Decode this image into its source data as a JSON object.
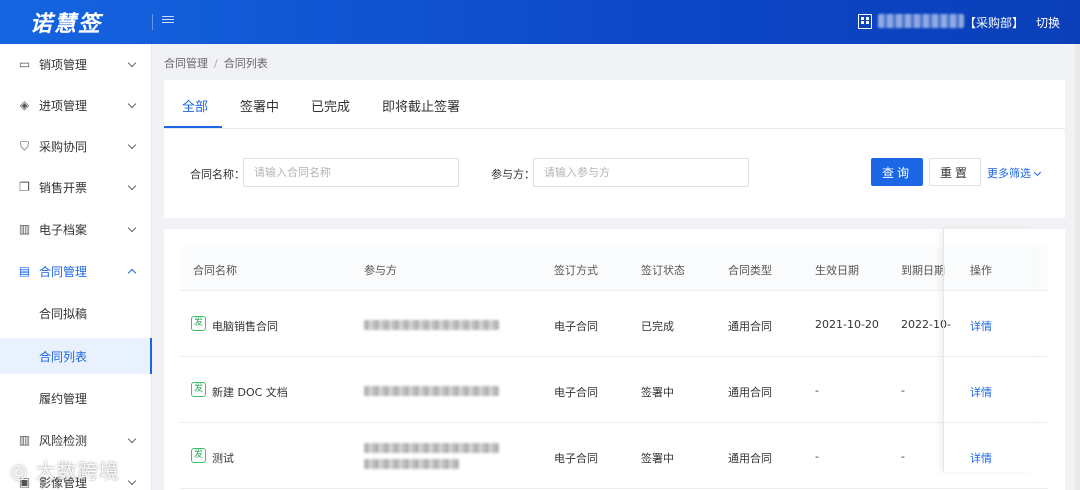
{
  "header": {
    "logo": "诺慧签",
    "dept": "【采购部】",
    "switch": "切换"
  },
  "sidebar": {
    "items": [
      {
        "label": "销项管理",
        "icon": "invoice-icon"
      },
      {
        "label": "进项管理",
        "icon": "layers-icon"
      },
      {
        "label": "采购协同",
        "icon": "shield-icon"
      },
      {
        "label": "销售开票",
        "icon": "document-copy-icon"
      },
      {
        "label": "电子档案",
        "icon": "archive-icon"
      },
      {
        "label": "合同管理",
        "icon": "contract-icon"
      },
      {
        "label": "风险检测",
        "icon": "risk-icon"
      },
      {
        "label": "影像管理",
        "icon": "image-icon"
      }
    ],
    "sub_items": [
      "合同拟稿",
      "合同列表",
      "履约管理"
    ]
  },
  "breadcrumb": {
    "parent": "合同管理",
    "separator": "/",
    "current": "合同列表"
  },
  "tabs": [
    "全部",
    "签署中",
    "已完成",
    "即将截止签署"
  ],
  "filters": {
    "name_label": "合同名称：",
    "name_placeholder": "请输入合同名称",
    "party_label": "参与方：",
    "party_placeholder": "请输入参与方",
    "query": "查询",
    "reset": "重置",
    "more": "更多筛选"
  },
  "table": {
    "headers": [
      "合同名称",
      "参与方",
      "签订方式",
      "签订状态",
      "合同类型",
      "生效日期",
      "到期日期",
      "操作"
    ],
    "badge": "发",
    "rows": [
      {
        "name": "电脑销售合同",
        "method": "电子合同",
        "status": "已完成",
        "type": "通用合同",
        "start": "2021-10-20",
        "end": "2022-10-",
        "action": "详情"
      },
      {
        "name": "新建 DOC 文档",
        "method": "电子合同",
        "status": "签署中",
        "type": "通用合同",
        "start": "-",
        "end": "-",
        "action": "详情"
      },
      {
        "name": "测试",
        "method": "电子合同",
        "status": "签署中",
        "type": "通用合同",
        "start": "-",
        "end": "-",
        "action": "详情"
      }
    ]
  },
  "watermark": "大数跨境",
  "colors": {
    "primary": "#1b67e6",
    "header": "#1565e0",
    "badge": "#3fbf6b"
  }
}
